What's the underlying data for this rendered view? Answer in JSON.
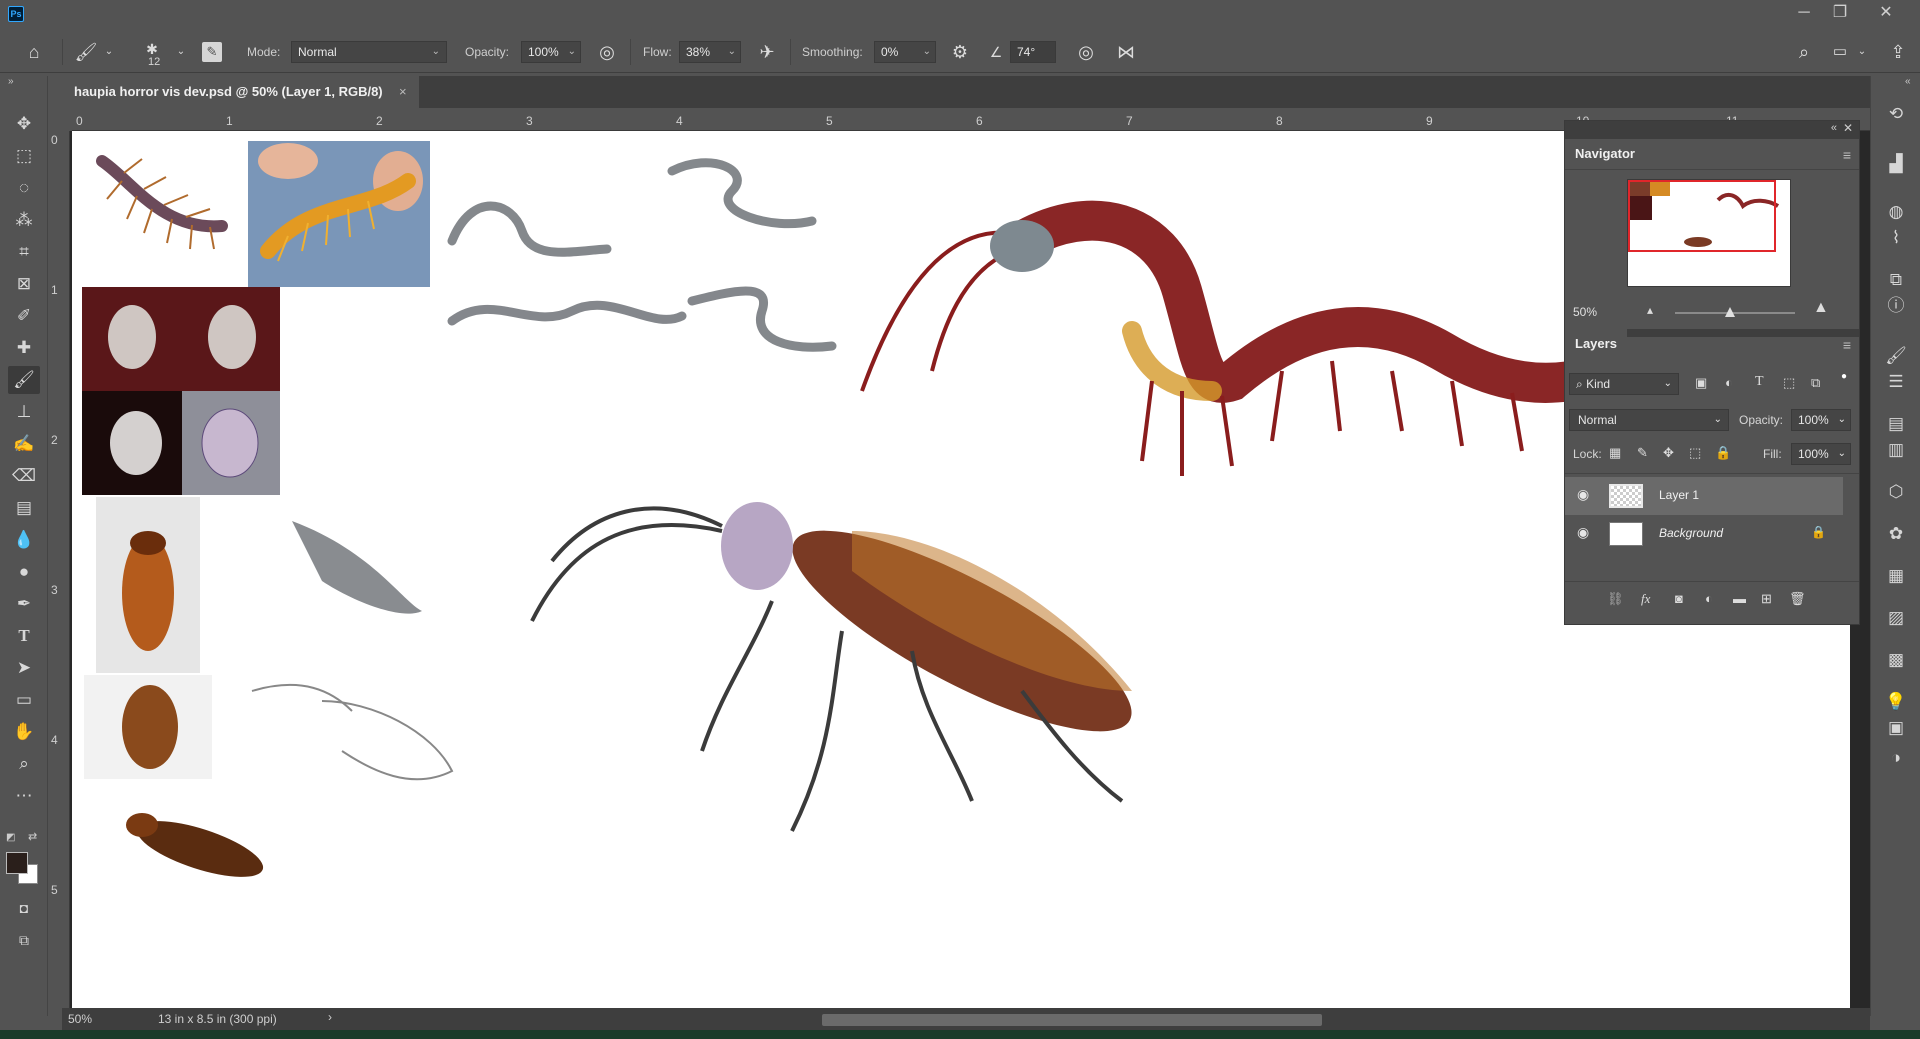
{
  "app": {
    "logo": "Ps"
  },
  "window_controls": {
    "minimize": "─",
    "restore": "❐",
    "close": "✕"
  },
  "options_bar": {
    "brush_size": "12",
    "mode_label": "Mode:",
    "mode_value": "Normal",
    "opacity_label": "Opacity:",
    "opacity_value": "100%",
    "flow_label": "Flow:",
    "flow_value": "38%",
    "smoothing_label": "Smoothing:",
    "smoothing_value": "0%",
    "angle_value": "74°"
  },
  "document_tab": {
    "title": "haupia horror vis dev.psd @ 50% (Layer 1, RGB/8)",
    "close": "×"
  },
  "rulers": {
    "top": [
      "0",
      "1",
      "2",
      "3",
      "4",
      "5",
      "6",
      "7",
      "8",
      "9",
      "10",
      "11"
    ],
    "left": [
      "0",
      "1",
      "2",
      "3",
      "4",
      "5"
    ]
  },
  "status_bar": {
    "zoom": "50%",
    "doc_size": "13 in x 8.5 in (300 ppi)",
    "arrow": "›"
  },
  "navigator": {
    "title": "Navigator",
    "zoom": "50%",
    "accent": "#e0262b"
  },
  "layers_panel": {
    "title": "Layers",
    "kind_label": "Kind",
    "blend_mode": "Normal",
    "opacity_label": "Opacity:",
    "opacity_value": "100%",
    "lock_label": "Lock:",
    "fill_label": "Fill:",
    "fill_value": "100%",
    "layers": [
      {
        "name": "Layer 1",
        "selected": true
      },
      {
        "name": "Background",
        "selected": false,
        "locked": true
      }
    ]
  },
  "colors": {
    "foreground": "#2a1f1b",
    "background": "#ffffff"
  }
}
